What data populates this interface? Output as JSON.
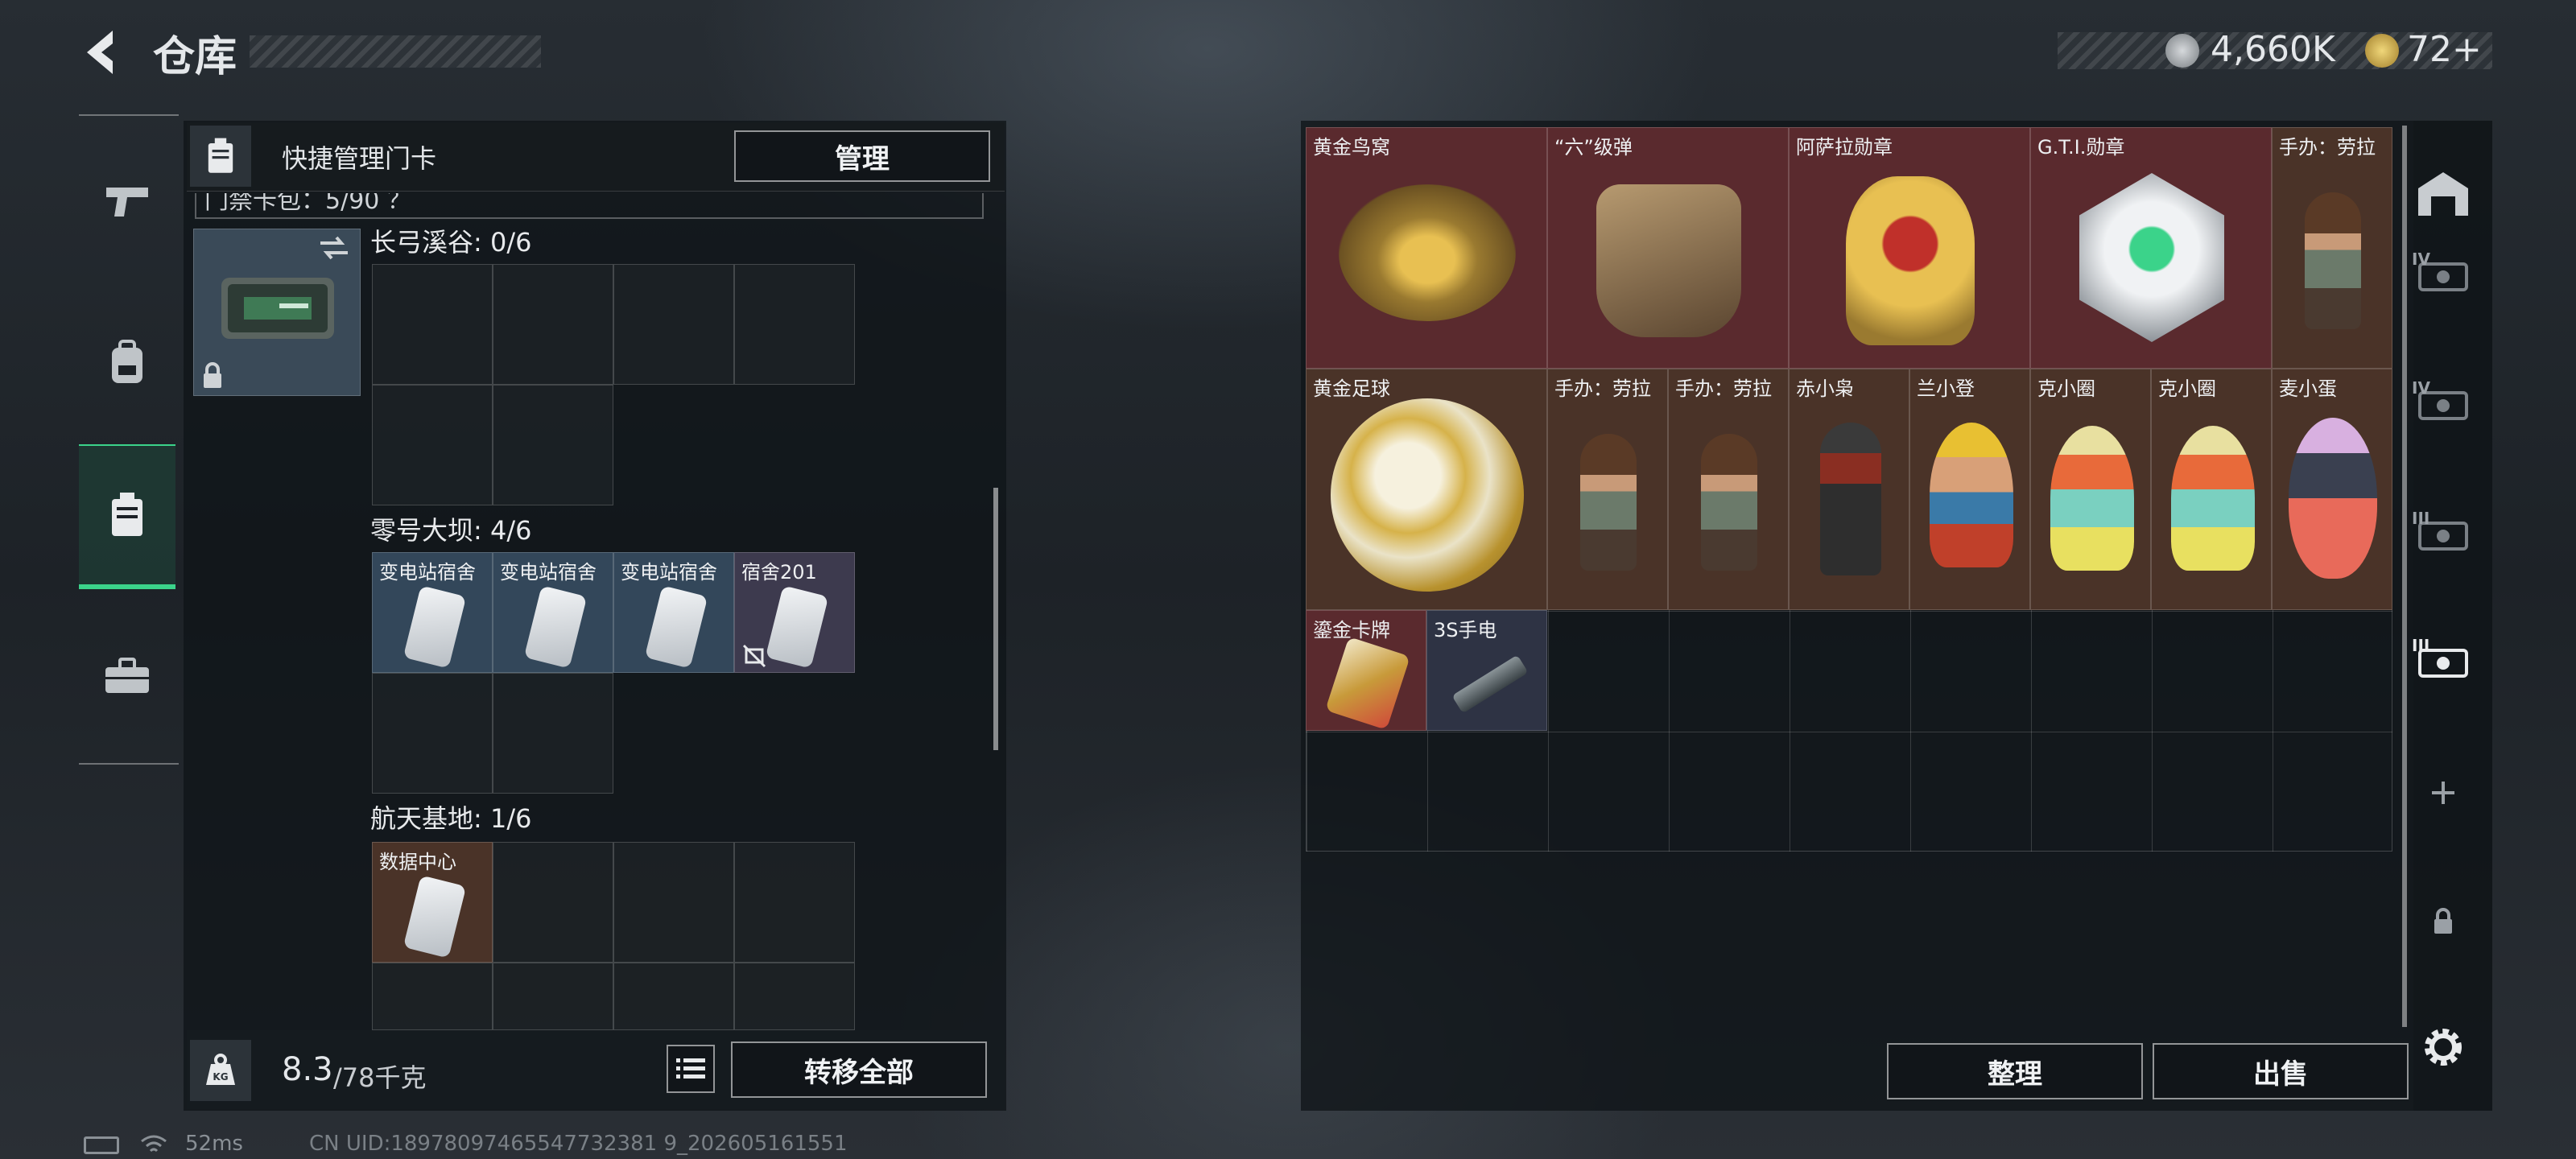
{
  "header": {
    "title": "仓库",
    "back_icon": "chevron-left-icon"
  },
  "currency": {
    "silver": "4,660K",
    "gold": "72+"
  },
  "quick": {
    "title": "快捷管理门卡",
    "manage_label": "管理",
    "top_partial": "门禁卡包：5/90 ？"
  },
  "sections": [
    {
      "title": "长弓溪谷: 0/6",
      "cards": []
    },
    {
      "title": "零号大坝: 4/6",
      "cards": [
        "变电站宿舍",
        "变电站宿舍",
        "变电站宿舍",
        "宿舍201"
      ]
    },
    {
      "title": "航天基地: 1/6",
      "cards": [
        "数据中心"
      ]
    }
  ],
  "bottom_left": {
    "weight_value": "8.3",
    "weight_max": "/78千克",
    "transfer_all_label": "转移全部"
  },
  "grid_items": [
    "黄金鸟窝",
    "“六”级弹",
    "阿萨拉勋章",
    "G.T.I.勋章",
    "手办：劳拉",
    "黄金足球",
    "手办：劳拉",
    "手办：劳拉",
    "赤小枭",
    "兰小登",
    "克小圈",
    "克小圈",
    "麦小蛋",
    "鎏金卡牌",
    "3S手电"
  ],
  "actions": {
    "sort_label": "整理",
    "sell_label": "出售"
  },
  "status": {
    "ping": "52ms",
    "uid": "CN UID:18978097465547732381 9_202605161551"
  },
  "right_tabs": [
    "IV",
    "IV",
    "III",
    "III"
  ],
  "colors": {
    "accent": "#3bd38a",
    "red_bg": "#5a2a2e",
    "brown_bg": "#4a3328",
    "blue_bg": "#33475a"
  }
}
